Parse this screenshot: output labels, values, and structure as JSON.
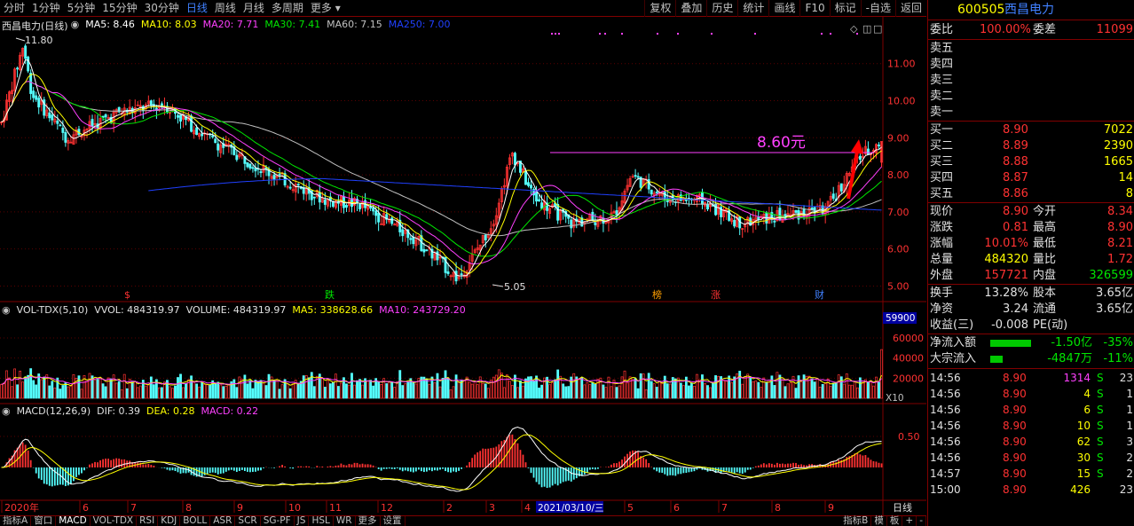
{
  "toolbar": {
    "periods": [
      "分时",
      "1分钟",
      "5分钟",
      "15分钟",
      "30分钟",
      "日线",
      "周线",
      "月线",
      "多周期",
      "更多 ▾"
    ],
    "active_period": "日线",
    "tools": [
      "复权",
      "叠加",
      "历史",
      "统计",
      "画线",
      "F10",
      "标记",
      "-自选",
      "返回"
    ]
  },
  "main_legend": {
    "title": "西昌电力(日线)",
    "ma5": "MA5: 8.46",
    "ma10": "MA10: 8.03",
    "ma20": "MA20: 7.71",
    "ma30": "MA30: 7.41",
    "ma60": "MA60: 7.15",
    "ma250": "MA250: 7.00"
  },
  "vol_legend": {
    "name": "VOL-TDX(5,10)",
    "vvol": "VVOL: 484319.97",
    "volume": "VOLUME: 484319.97",
    "ma5": "MA5: 338628.66",
    "ma10": "MA10: 243729.20"
  },
  "macd_legend": {
    "name": "MACD(12,26,9)",
    "dif": "DIF: 0.39",
    "dea": "DEA: 0.28",
    "macd": "MACD: 0.22"
  },
  "annotations": {
    "high": "11.80",
    "low": "5.05",
    "level": "8.60元",
    "vol_marker": "59900",
    "vol_unit": "X10",
    "date_tip": "2021/03/10/三"
  },
  "event_labels": [
    "$",
    "跌",
    "榜",
    "涨",
    "财"
  ],
  "axes": {
    "price_ticks": [
      "11.00",
      "10.00",
      "9.00",
      "8.00",
      "7.00",
      "6.00",
      "5.00"
    ],
    "vol_ticks": [
      "60000",
      "40000",
      "20000"
    ],
    "macd_ticks": [
      "0.50"
    ],
    "x_labels": [
      "2020年",
      "6",
      "7",
      "8",
      "9",
      "10",
      "11",
      "12",
      "2",
      "3",
      "4",
      "5",
      "6",
      "7",
      "8",
      "9"
    ],
    "period_label": "日线"
  },
  "bottom_tabs": [
    "指标A",
    "窗口",
    "MACD",
    "VOL-TDX",
    "RSI",
    "KDJ",
    "BOLL",
    "ASR",
    "SCR",
    "SG-PF",
    "JS",
    "HSL",
    "WR",
    "更多",
    "设置"
  ],
  "bottom_right": [
    "指标B",
    "模",
    "板",
    "+",
    "-"
  ],
  "panel": {
    "code": "600505",
    "name": "西昌电力",
    "weibi_label": "委比",
    "weibi": "100.00%",
    "weicha_label": "委差",
    "weicha": "11099",
    "asks": [
      {
        "label": "卖五",
        "price": "",
        "vol": ""
      },
      {
        "label": "卖四",
        "price": "",
        "vol": ""
      },
      {
        "label": "卖三",
        "price": "",
        "vol": ""
      },
      {
        "label": "卖二",
        "price": "",
        "vol": ""
      },
      {
        "label": "卖一",
        "price": "",
        "vol": ""
      }
    ],
    "bids": [
      {
        "label": "买一",
        "price": "8.90",
        "vol": "7022"
      },
      {
        "label": "买二",
        "price": "8.89",
        "vol": "2390"
      },
      {
        "label": "买三",
        "price": "8.88",
        "vol": "1665"
      },
      {
        "label": "买四",
        "price": "8.87",
        "vol": "14"
      },
      {
        "label": "买五",
        "price": "8.86",
        "vol": "8"
      }
    ],
    "quote": [
      {
        "l1": "现价",
        "v1": "8.90",
        "l2": "今开",
        "v2": "8.34"
      },
      {
        "l1": "涨跌",
        "v1": "0.81",
        "l2": "最高",
        "v2": "8.90"
      },
      {
        "l1": "涨幅",
        "v1": "10.01%",
        "l2": "最低",
        "v2": "8.21"
      },
      {
        "l1": "总量",
        "v1": "484320",
        "l2": "量比",
        "v2": "1.72"
      },
      {
        "l1": "外盘",
        "v1": "157721",
        "l2": "内盘",
        "v2": "326599"
      }
    ],
    "fund": [
      {
        "l1": "换手",
        "v1": "13.28%",
        "l2": "股本",
        "v2": "3.65亿"
      },
      {
        "l1": "净资",
        "v1": "3.24",
        "l2": "流通",
        "v2": "3.65亿"
      },
      {
        "l1": "收益(三)",
        "v1": "-0.008",
        "l2": "PE(动)",
        "v2": ""
      }
    ],
    "flows": [
      {
        "label": "净流入额",
        "value": "-1.50亿",
        "pct": "-35%",
        "bar": 0.82
      },
      {
        "label": "大宗流入",
        "value": "-4847万",
        "pct": "-11%",
        "bar": 0.25
      }
    ],
    "ticks": [
      {
        "time": "14:56",
        "price": "8.90",
        "vol": "1314",
        "side": "S",
        "n": "23"
      },
      {
        "time": "14:56",
        "price": "8.90",
        "vol": "4",
        "side": "S",
        "n": "1"
      },
      {
        "time": "14:56",
        "price": "8.90",
        "vol": "6",
        "side": "S",
        "n": "1"
      },
      {
        "time": "14:56",
        "price": "8.90",
        "vol": "10",
        "side": "S",
        "n": "1"
      },
      {
        "time": "14:56",
        "price": "8.90",
        "vol": "62",
        "side": "S",
        "n": "3"
      },
      {
        "time": "14:56",
        "price": "8.90",
        "vol": "30",
        "side": "S",
        "n": "2"
      },
      {
        "time": "14:57",
        "price": "8.90",
        "vol": "15",
        "side": "S",
        "n": "2"
      },
      {
        "time": "15:00",
        "price": "8.90",
        "vol": "426",
        "side": "",
        "n": "23"
      }
    ]
  },
  "colors": {
    "up": "#ff3232",
    "down": "#54ffff",
    "ma5": "#ffffff",
    "ma10": "#ffff00",
    "ma20": "#ff40ff",
    "ma30": "#00e600",
    "ma60": "#c0c0c0",
    "ma250": "#2040ff",
    "grid": "#800000"
  }
}
